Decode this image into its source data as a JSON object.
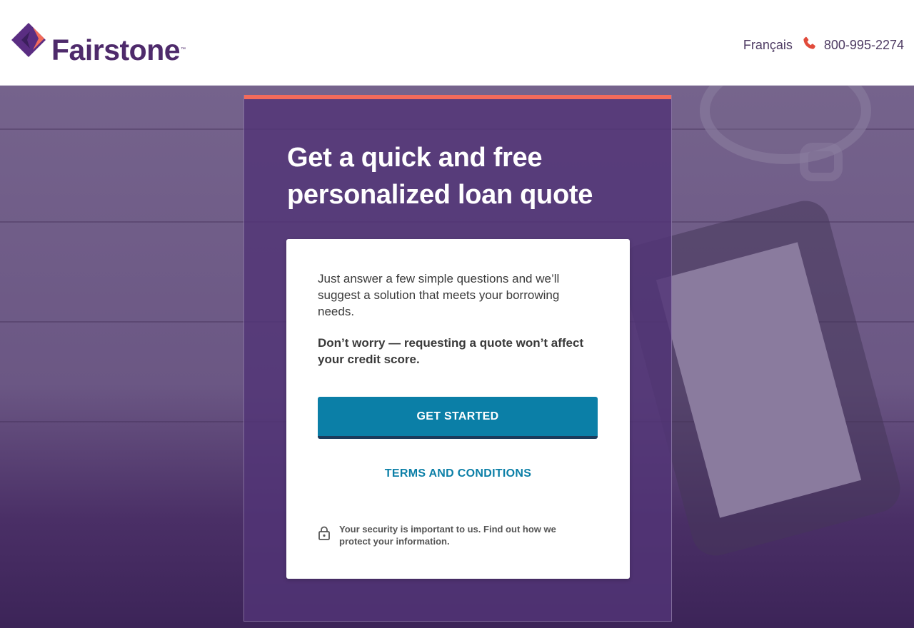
{
  "header": {
    "brand": "Fairstone",
    "trademark": "™",
    "language_link": "Français",
    "phone_number": "800-995-2274"
  },
  "main": {
    "title": "Get a quick and free personalized loan quote",
    "intro": "Just answer a few simple questions and we’ll suggest a solution that meets your borrowing needs.",
    "credit_note": "Don’t worry — requesting a quote won’t affect your credit score.",
    "cta_label": "GET STARTED",
    "terms_link": "TERMS AND CONDITIONS",
    "security_note": "Your security is important to us. Find out how we protect your information."
  },
  "colors": {
    "brand_purple": "#4e2a6b",
    "accent_coral": "#f26b5b",
    "cta_blue": "#0b7fa7"
  },
  "icons": [
    "fairstone-logo-mark",
    "phone-icon",
    "lock-icon"
  ]
}
